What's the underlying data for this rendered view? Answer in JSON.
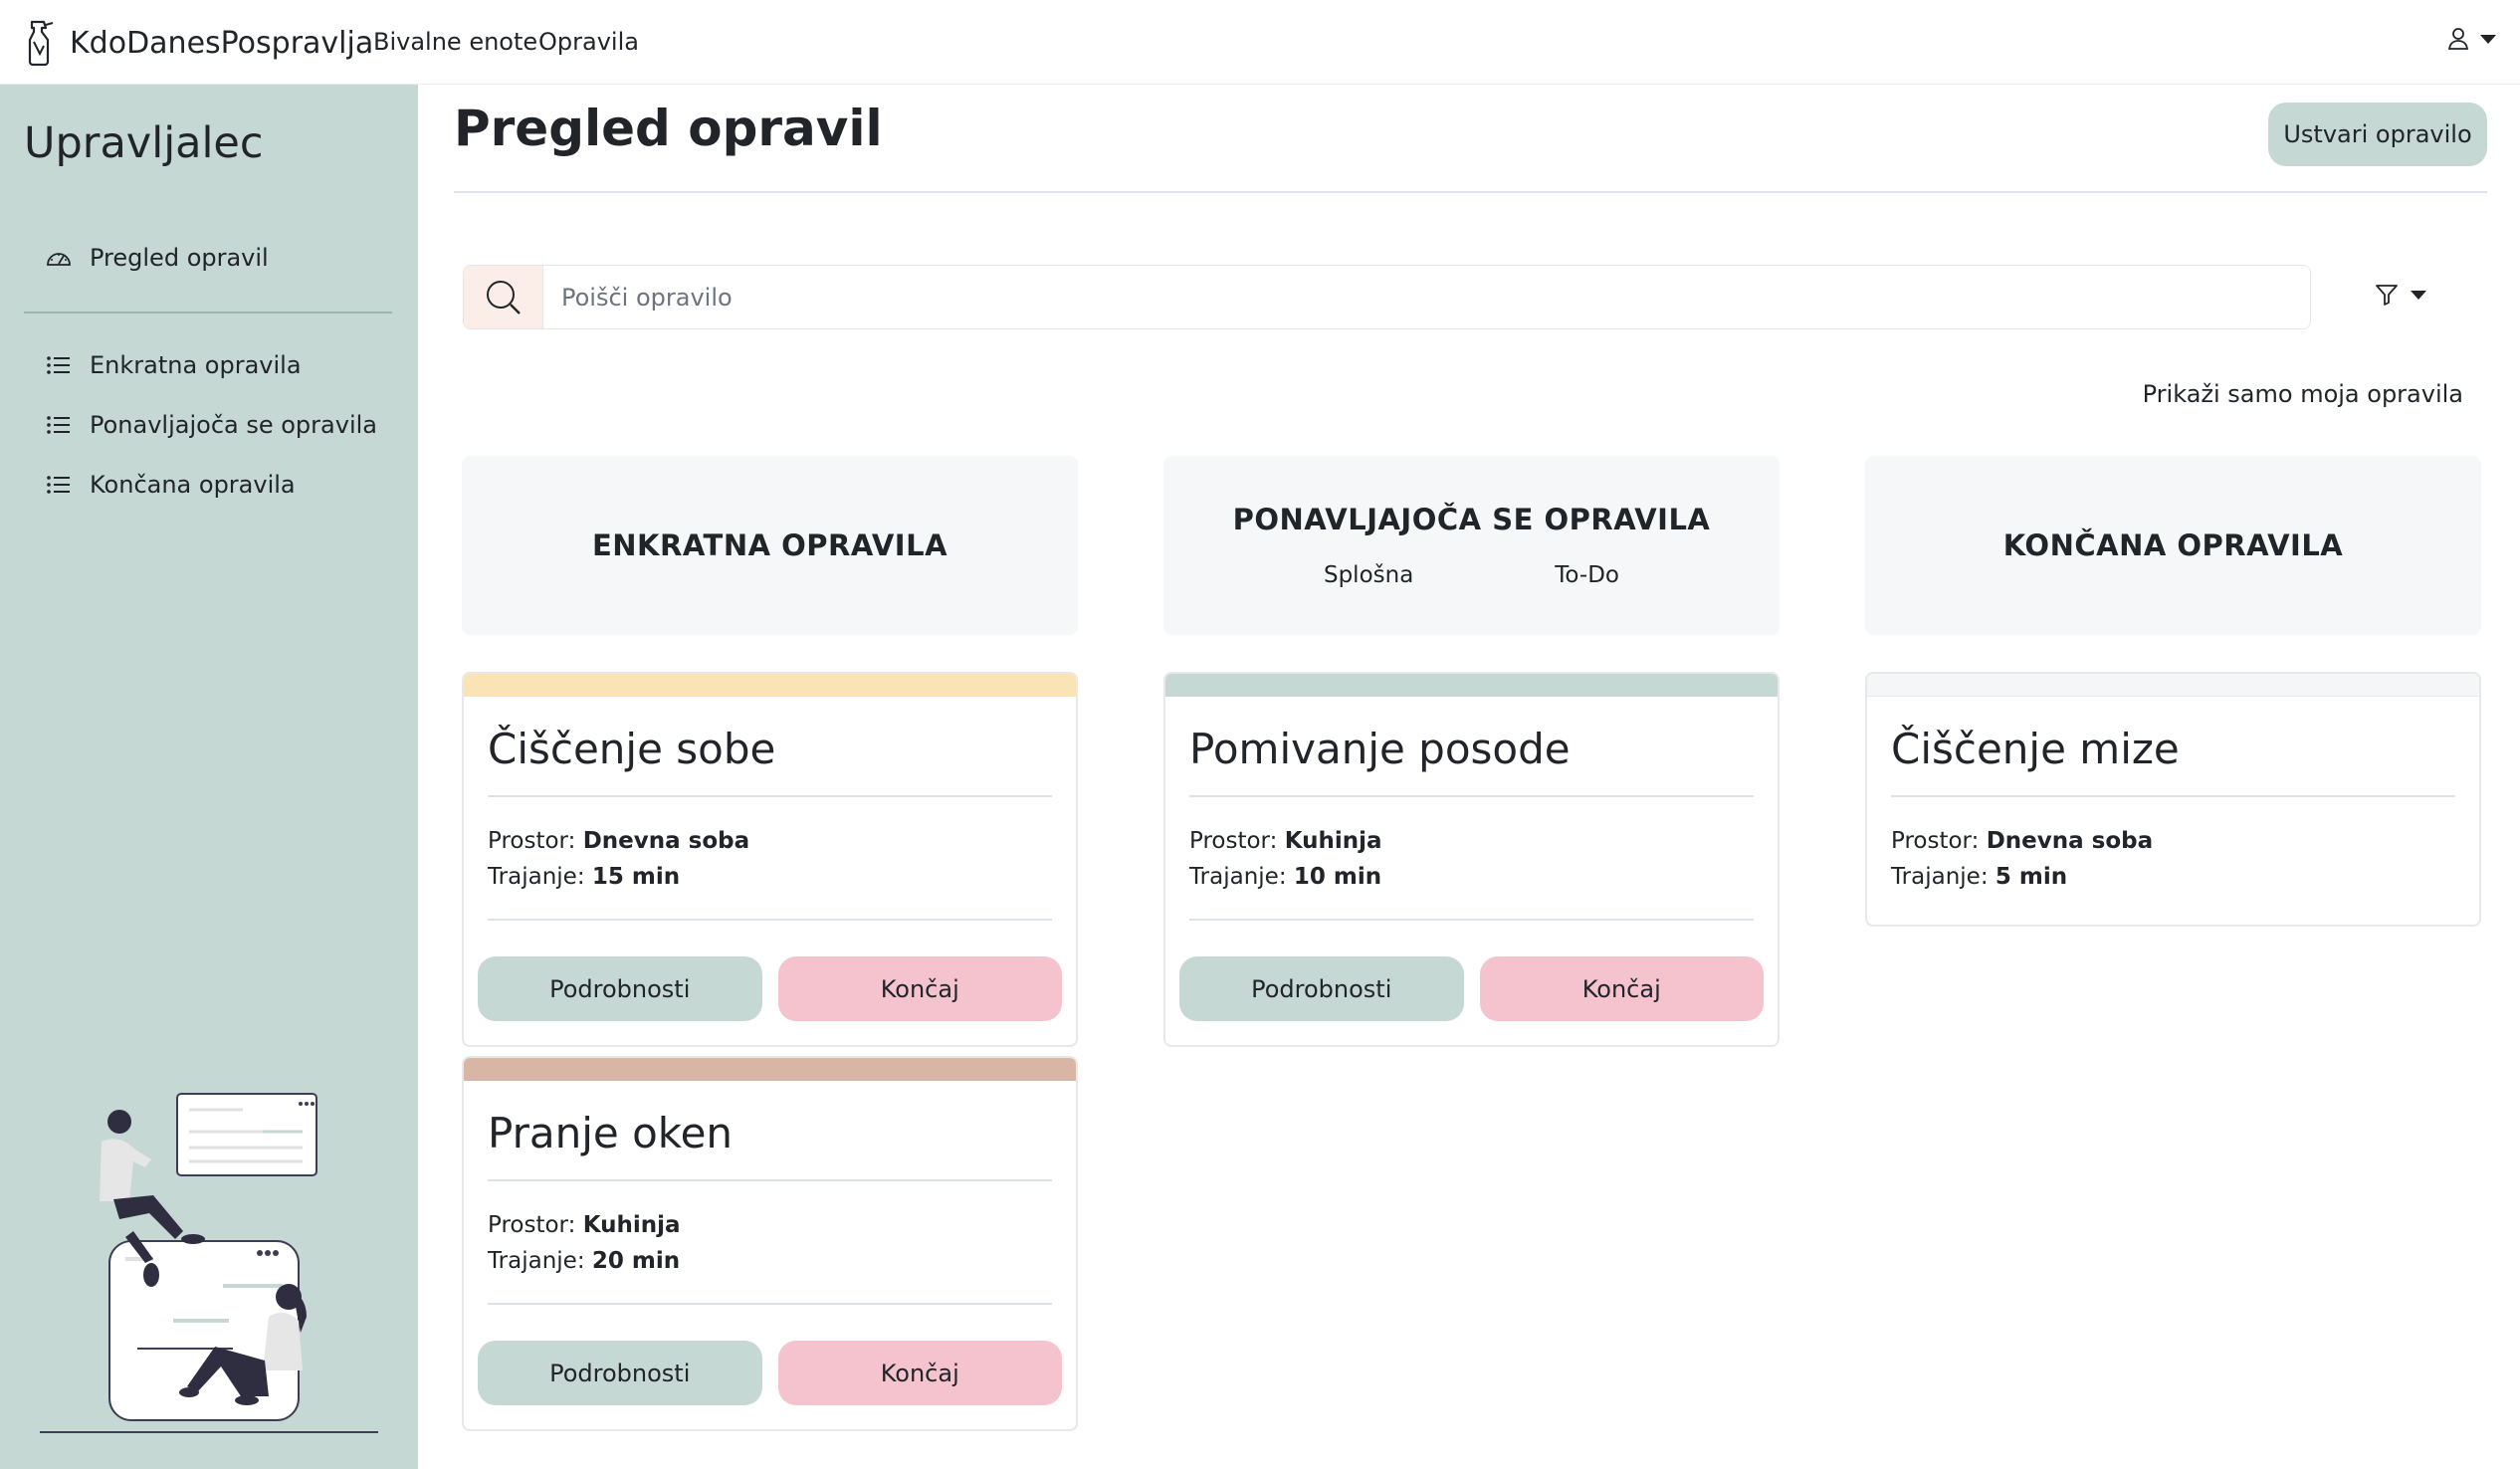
{
  "topnav": {
    "brand": "KdoDanesPospravlja",
    "links": [
      "Bivalne enote",
      "Opravila"
    ]
  },
  "sidebar": {
    "title": "Upravljalec",
    "items": [
      {
        "label": "Pregled opravil",
        "icon": "dashboard-icon"
      },
      {
        "label": "Enkratna opravila",
        "icon": "list-icon"
      },
      {
        "label": "Ponavljajoča se opravila",
        "icon": "list-icon"
      },
      {
        "label": "Končana opravila",
        "icon": "list-icon"
      }
    ]
  },
  "main": {
    "title": "Pregled opravil",
    "create_label": "Ustvari opravilo",
    "search_placeholder": "Poišči opravilo",
    "only_mine": "Prikaži samo moja opravila"
  },
  "columns": {
    "one_time": {
      "title": "ENKRATNA OPRAVILA"
    },
    "recurring": {
      "title": "PONAVLJAJOČA SE OPRAVILA",
      "tabs": [
        "Splošna",
        "To-Do"
      ]
    },
    "done": {
      "title": "KONČANA OPRAVILA"
    }
  },
  "labels": {
    "room": "Prostor:",
    "duration": "Trajanje:",
    "details": "Podrobnosti",
    "finish": "Končaj"
  },
  "cards": [
    {
      "title": "Čiščenje sobe",
      "room": "Dnevna soba",
      "duration": "15 min",
      "color": "#fae3b4"
    },
    {
      "title": "Pranje oken",
      "room": "Kuhinja",
      "duration": "20 min",
      "color": "#d8b5a5"
    },
    {
      "title": "Pomivanje posode",
      "room": "Kuhinja",
      "duration": "10 min",
      "color": "#c5d8d4"
    },
    {
      "title": "Čiščenje mize",
      "room": "Dnevna soba",
      "duration": "5 min",
      "color": "#f5f6f7"
    }
  ],
  "colors": {
    "accent": "#c5d8d4",
    "finish": "#f5c3cd",
    "search_addon": "#fbeee8"
  }
}
